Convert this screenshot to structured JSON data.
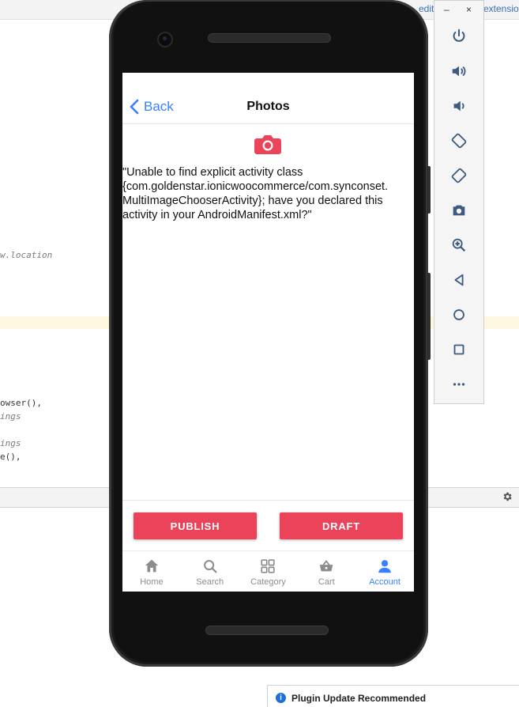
{
  "ide": {
    "top_right_1": "editio",
    "top_right_2": "extensio",
    "code_lines": [
      {
        "text": "w.location",
        "comment": true
      },
      {
        "text": "owser(),",
        "comment": false
      },
      {
        "text": "ings",
        "comment": true
      },
      {
        "text": "ings",
        "comment": true
      },
      {
        "text": "e(),",
        "comment": false
      }
    ],
    "notification": "Plugin Update Recommended"
  },
  "emulator": {
    "minimize": "–",
    "close": "×",
    "controls": [
      "power-icon",
      "volume-up-icon",
      "volume-down-icon",
      "rotate-left-icon",
      "rotate-right-icon",
      "screenshot-icon",
      "zoom-icon",
      "back-icon",
      "home-icon",
      "overview-icon",
      "more-icon"
    ]
  },
  "app": {
    "header": {
      "back_label": "Back",
      "title": "Photos"
    },
    "error_message": "\"Unable to find explicit activity class {com.goldenstar.ionicwoocommerce/com.synconset. MultiImageChooserActivity}; have you declared this activity in your AndroidManifest.xml?\"",
    "buttons": {
      "publish": "PUBLISH",
      "draft": "DRAFT"
    },
    "tabs": [
      {
        "label": "Home",
        "icon": "home-icon",
        "active": false
      },
      {
        "label": "Search",
        "icon": "search-icon",
        "active": false
      },
      {
        "label": "Category",
        "icon": "grid-icon",
        "active": false
      },
      {
        "label": "Cart",
        "icon": "basket-icon",
        "active": false
      },
      {
        "label": "Account",
        "icon": "person-icon",
        "active": true
      }
    ],
    "colors": {
      "accent": "#3880ff",
      "danger": "#eb445a"
    }
  }
}
